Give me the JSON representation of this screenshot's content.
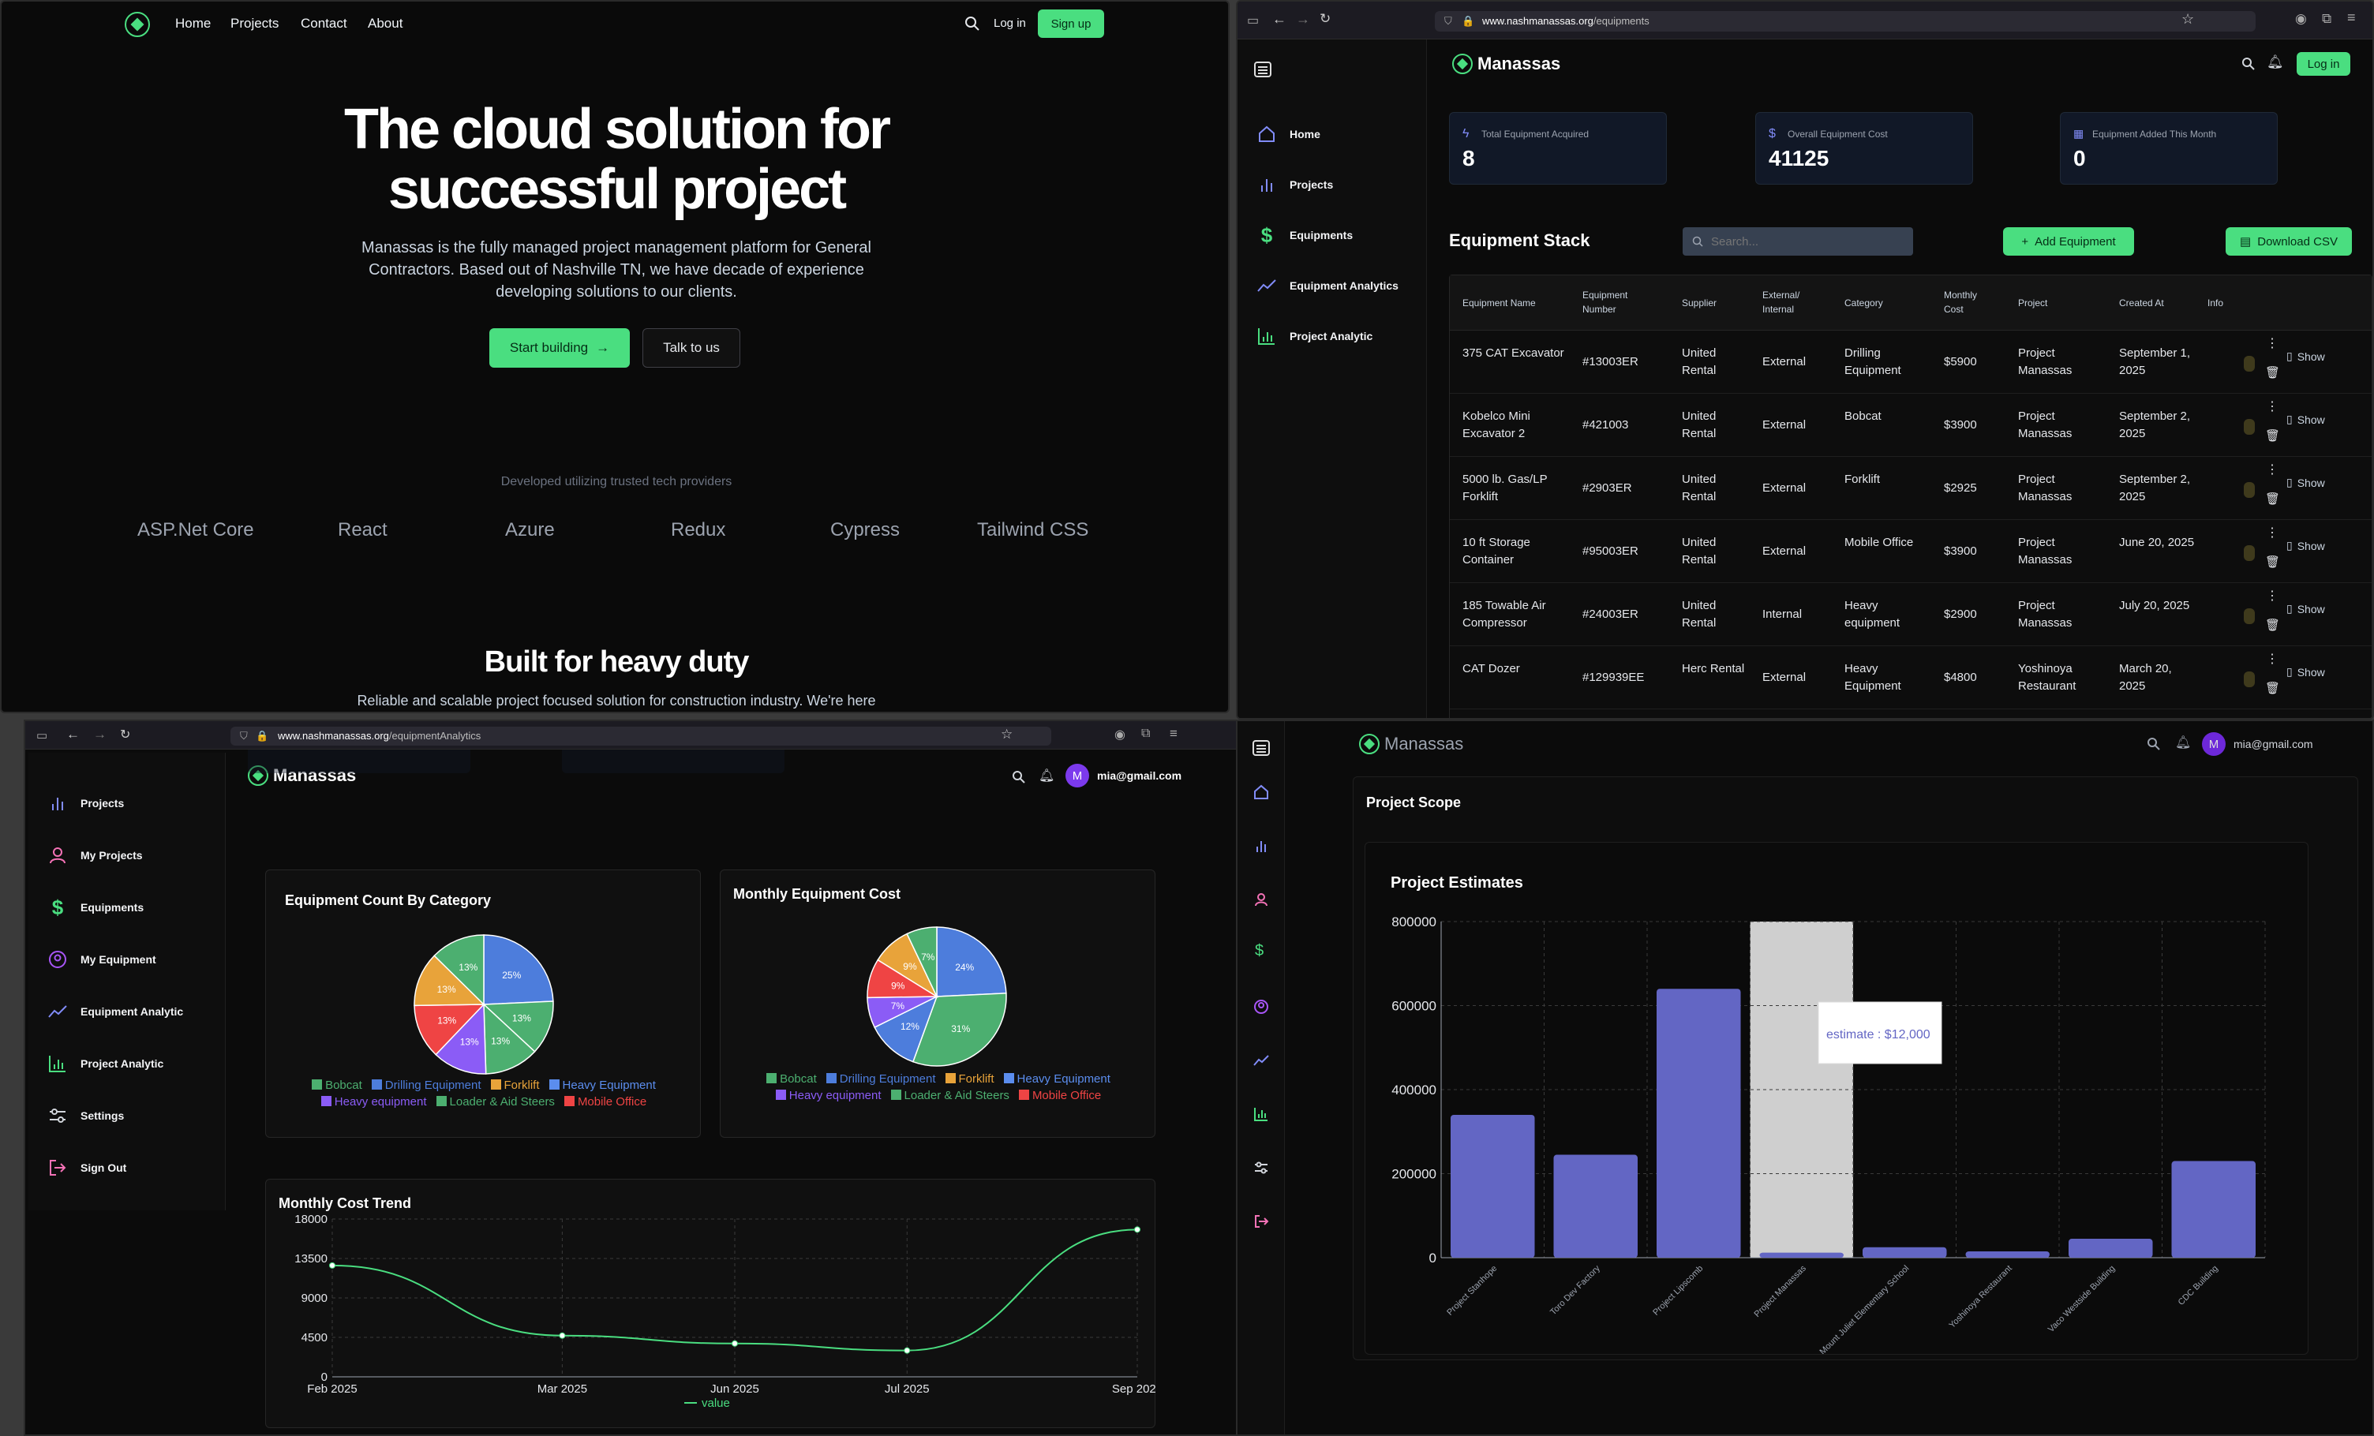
{
  "q1": {
    "nav": {
      "home": "Home",
      "projects": "Projects",
      "contact": "Contact",
      "about": "About",
      "login": "Log in",
      "signup": "Sign up"
    },
    "hero": {
      "title_line1": "The cloud solution for",
      "title_line2": "successful project",
      "desc_line1": "Manassas is the fully managed project management platform for General",
      "desc_line2": "Contractors. Based out of Nashville TN, we have decade of experience",
      "desc_line3": "developing solutions to our clients.",
      "cta_primary": "Start building",
      "cta_secondary": "Talk to us"
    },
    "providers_caption": "Developed utilizing trusted tech providers",
    "providers": [
      "ASP.Net Core",
      "React",
      "Azure",
      "Redux",
      "Cypress",
      "Tailwind CSS"
    ],
    "section_title": "Built for heavy duty",
    "section_desc": "Reliable and scalable project focused solution for construction industry. We're here"
  },
  "q2": {
    "url_domain": "www.nashmanassas.org",
    "url_path": "/equipments",
    "brand": "Manassas",
    "login": "Log in",
    "sidebar": [
      "Home",
      "Projects",
      "Equipments",
      "Equipment Analytics",
      "Project Analytic"
    ],
    "stats": [
      {
        "title": "Total Equipment Acquired",
        "value": "8"
      },
      {
        "title": "Overall Equipment Cost",
        "value": "41125"
      },
      {
        "title": "Equipment Added This Month",
        "value": "0"
      }
    ],
    "section_title": "Equipment Stack",
    "search_placeholder": "Search...",
    "add_button": "Add Equipment",
    "download_button": "Download CSV",
    "columns": [
      "Equipment Name",
      "Equipment Number",
      "Supplier",
      "External/ Internal",
      "Category",
      "Monthly Cost",
      "Project",
      "Created At",
      "Info"
    ],
    "show_label": "Show",
    "rows": [
      {
        "name": "375 CAT Excavator",
        "number": "#13003ER",
        "supplier": "United Rental",
        "ext": "External",
        "category": "Drilling Equipment",
        "cost": "$5900",
        "project": "Project Manassas",
        "created": "September 1, 2025"
      },
      {
        "name": "Kobelco Mini Excavator 2",
        "number": "#421003",
        "supplier": "United Rental",
        "ext": "External",
        "category": "Bobcat",
        "cost": "$3900",
        "project": "Project Manassas",
        "created": "September 2, 2025"
      },
      {
        "name": "5000 lb. Gas/LP Forklift",
        "number": "#2903ER",
        "supplier": "United Rental",
        "ext": "External",
        "category": "Forklift",
        "cost": "$2925",
        "project": "Project Manassas",
        "created": "September 2, 2025"
      },
      {
        "name": "10 ft Storage Container",
        "number": "#95003ER",
        "supplier": "United Rental",
        "ext": "External",
        "category": "Mobile Office",
        "cost": "$3900",
        "project": "Project Manassas",
        "created": "June 20, 2025"
      },
      {
        "name": "185 Towable Air Compressor",
        "number": "#24003ER",
        "supplier": "United Rental",
        "ext": "Internal",
        "category": "Heavy equipment",
        "cost": "$2900",
        "project": "Project Manassas",
        "created": "July 20, 2025"
      },
      {
        "name": "CAT Dozer",
        "number": "#129939EE",
        "supplier": "Herc Rental",
        "ext": "External",
        "category": "Heavy Equipment",
        "cost": "$4800",
        "project": "Yoshinoya Restaurant",
        "created": "March 20, 2025"
      }
    ]
  },
  "q3": {
    "url_domain": "www.nashmanassas.org",
    "url_path": "/equipmentAnalytics",
    "brand": "Manassas",
    "user_email": "mia@gmail.com",
    "avatar_letter": "M",
    "sidebar": [
      "Projects",
      "My Projects",
      "Equipments",
      "My Equipment",
      "Equipment Analytic",
      "Project Analytic",
      "Settings",
      "Sign Out"
    ],
    "legend": [
      "Bobcat",
      "Drilling Equipment",
      "Forklift",
      "Heavy Equipment",
      "Heavy equipment",
      "Loader & Aid Steers",
      "Mobile Office"
    ],
    "legend_colors": [
      "#4caf70",
      "#4d7ddc",
      "#e8a33a",
      "#5b8dee",
      "#8b5cf6",
      "#4caf70",
      "#ef4444"
    ]
  },
  "q4": {
    "brand": "Manassas",
    "user_email": "mia@gmail.com",
    "avatar_letter": "M",
    "panel_title": "Project Scope"
  },
  "chart_data": [
    {
      "type": "pie",
      "title": "Equipment Count By Category",
      "labels": [
        "Drilling Equipment",
        "Bobcat",
        "Loader & Aid Steers",
        "Heavy equipment",
        "Mobile Office",
        "Forklift",
        "Heavy Equipment"
      ],
      "values": [
        25,
        13,
        13,
        13,
        13,
        13,
        13
      ],
      "value_labels": [
        "25%",
        "13%",
        "13%",
        "13%",
        "13%",
        "13%",
        "13%"
      ],
      "colors": [
        "#4d7ddc",
        "#4caf70",
        "#4caf70",
        "#8b5cf6",
        "#ef4444",
        "#e8a33a",
        "#4caf70"
      ]
    },
    {
      "type": "pie",
      "title": "Monthly Equipment Cost",
      "labels": [
        "Drilling Equipment",
        "Forklift",
        "Heavy equipment",
        "Heavy Equipment",
        "Mobile Office",
        "Bobcat",
        "Loader & Aid Steers"
      ],
      "values": [
        24,
        31,
        12,
        7,
        9,
        9,
        7
      ],
      "value_labels": [
        "24%",
        "31%",
        "12%",
        "7%",
        "9%",
        "9%",
        "7%"
      ],
      "colors": [
        "#4d7ddc",
        "#4caf70",
        "#4d7ddc",
        "#8b5cf6",
        "#ef4444",
        "#e8a33a",
        "#4caf70"
      ]
    },
    {
      "type": "line",
      "title": "Monthly Cost Trend",
      "x": [
        "Feb 2025",
        "Mar 2025",
        "Jun 2025",
        "Jul 2025",
        "Sep 2025"
      ],
      "series": [
        {
          "name": "value",
          "values": [
            12700,
            4700,
            3800,
            3000,
            16800
          ]
        }
      ],
      "yticks": [
        "0",
        "4500",
        "9000",
        "13500",
        "18000"
      ],
      "ylim": [
        0,
        18000
      ],
      "color": "#4ade80"
    },
    {
      "type": "bar",
      "title": "Project Estimates",
      "categories": [
        "Project Stanhope",
        "Toro Dev Factory",
        "Project Lipscomb",
        "Project Manassas",
        "Mount Juliet Elementary School",
        "Yoshinoya Restaurant",
        "Vaco Westside Building",
        "CDC Building"
      ],
      "values": [
        340000,
        245000,
        640000,
        12000,
        25000,
        15000,
        45000,
        230000
      ],
      "ylim": [
        0,
        800000
      ],
      "yticks": [
        "0",
        "200000",
        "400000",
        "600000",
        "800000"
      ],
      "tooltip": "estimate : $12,000",
      "color": "#6366c4"
    }
  ]
}
